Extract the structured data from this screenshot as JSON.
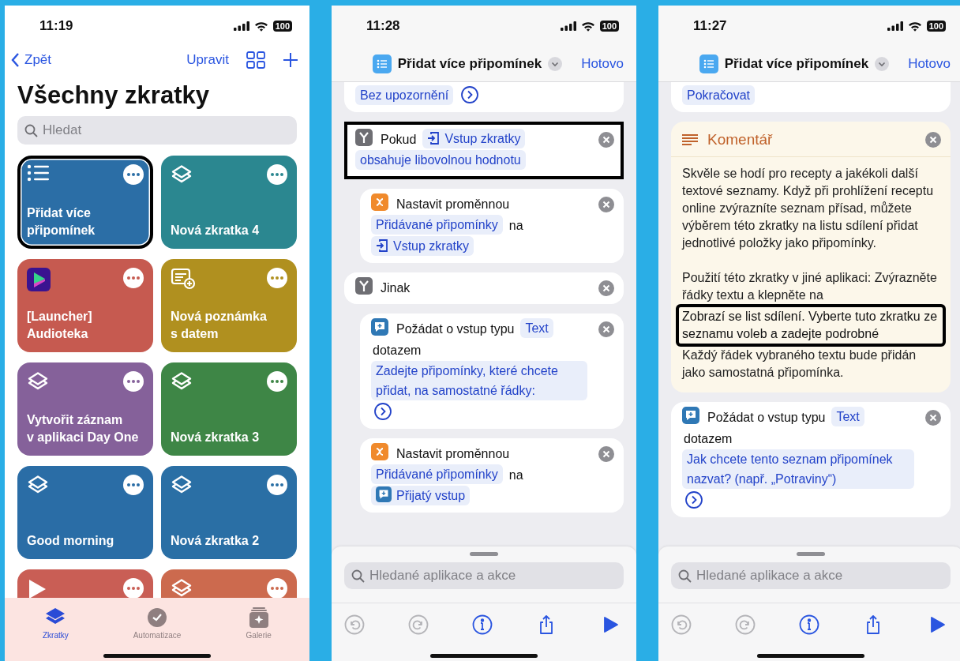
{
  "phones": [
    {
      "kind": "library",
      "time": "11:19",
      "battery": "100",
      "nav": {
        "back": "Zpět",
        "edit": "Upravit"
      },
      "title": "Všechny zkratky",
      "search": {
        "placeholder": "Hledat"
      },
      "tiles": [
        {
          "kind": "list",
          "title": "Přidat více\npřipomínek",
          "color": "#2b6ea6",
          "highlighted": true
        },
        {
          "kind": "layers",
          "title": "Nová zkratka 4",
          "color": "#2b8790",
          "highlighted": false
        },
        {
          "kind": "player",
          "title": "[Launcher]\nAudioteka",
          "color": "#c65a50",
          "highlighted": false
        },
        {
          "kind": "note",
          "title": "Nová poznámka\ns datem",
          "color": "#b0901f",
          "highlighted": false
        },
        {
          "kind": "layers",
          "title": "Vytvořit záznam\nv aplikaci Day One",
          "color": "#85619a",
          "highlighted": false
        },
        {
          "kind": "layers",
          "title": "Nová zkratka 3",
          "color": "#3e8646",
          "highlighted": false
        },
        {
          "kind": "layers",
          "title": "Good morning",
          "color": "#2a6da6",
          "highlighted": false
        },
        {
          "kind": "layers",
          "title": "Nová zkratka 2",
          "color": "#2a6fa5",
          "highlighted": false
        },
        {
          "kind": "play",
          "color": "#c95e55",
          "highlighted": false
        },
        {
          "kind": "layers",
          "color": "#cc6a4e",
          "highlighted": false
        }
      ],
      "tabs": [
        {
          "kind": "shortcuts",
          "label": "Zkratky",
          "selected": true
        },
        {
          "kind": "automation",
          "label": "Automatizace",
          "selected": false
        },
        {
          "kind": "gallery",
          "label": "Galerie",
          "selected": false
        }
      ]
    },
    {
      "kind": "editor",
      "time": "11:28",
      "battery": "100",
      "header": {
        "title": "Přidat více připomínek",
        "done": "Hotovo"
      },
      "actions": [
        {
          "kind": "partial",
          "parts": [
            {
              "kind": "chip",
              "text": "Bez upozornění"
            },
            {
              "kind": "more"
            }
          ]
        },
        {
          "kind": "if",
          "title": "Pokud",
          "highlighted": true,
          "parts": [
            {
              "kind": "input-chip",
              "text": "Vstup zkratky"
            },
            {
              "kind": "chip",
              "text": "obsahuje libovolnou hodnotu"
            }
          ],
          "children": [
            {
              "kind": "set",
              "title": "Nastavit proměnnou",
              "parts": [
                {
                  "kind": "chip",
                  "text": "Přidávané připomínky"
                },
                {
                  "kind": "label",
                  "text": "na"
                },
                {
                  "kind": "input-chip",
                  "text": "Vstup zkratky"
                }
              ]
            }
          ]
        },
        {
          "kind": "else",
          "title": "Jinak",
          "children": [
            {
              "kind": "ask",
              "title": "Požádat o vstup typu",
              "parts": [
                {
                  "kind": "chip",
                  "text": "Text"
                },
                {
                  "kind": "label",
                  "text": "dotazem"
                },
                {
                  "kind": "chip",
                  "text": "Zadejte připomínky, které chcete přidat, na samostatné řádky:"
                },
                {
                  "kind": "more"
                }
              ]
            },
            {
              "kind": "set",
              "title": "Nastavit proměnnou",
              "parts": [
                {
                  "kind": "chip",
                  "text": "Přidávané připomínky"
                },
                {
                  "kind": "label",
                  "text": "na"
                },
                {
                  "kind": "answer-chip",
                  "text": "Přijatý vstup"
                }
              ]
            }
          ]
        }
      ],
      "search": {
        "placeholder": "Hledané aplikace a akce"
      },
      "toolbar": [
        {
          "kind": "undo",
          "disabled": true
        },
        {
          "kind": "redo",
          "disabled": true
        },
        {
          "kind": "info",
          "disabled": false
        },
        {
          "kind": "share",
          "disabled": false
        },
        {
          "kind": "play",
          "disabled": false
        }
      ]
    },
    {
      "kind": "editor",
      "time": "11:27",
      "battery": "100",
      "header": {
        "title": "Přidat více připomínek",
        "done": "Hotovo"
      },
      "actions": [
        {
          "kind": "partial",
          "parts": [
            {
              "kind": "chip",
              "text": "Pokračovat"
            }
          ]
        },
        {
          "kind": "comment",
          "title": "Komentář",
          "blocks": [
            {
              "kind": "text",
              "text": "Skvěle se hodí pro recepty a jakékoli další textové seznamy. Když při prohlížení receptu online zvýrazníte seznam přísad, můžete výběrem této zkratky na listu sdílení přidat jednotlivé položky jako připomínky."
            },
            {
              "kind": "text",
              "text": "Použití této zkratky v jiné aplikaci: Zvýrazněte řádky textu a klepněte na"
            },
            {
              "kind": "callout",
              "text": "Zobrazí se list sdílení. Vyberte tuto zkratku ze seznamu voleb a zadejte podrobné"
            },
            {
              "kind": "text",
              "text": "Každý řádek vybraného textu bude přidán jako samostatná připomínka."
            }
          ]
        },
        {
          "kind": "ask",
          "title": "Požádat o vstup typu",
          "parts": [
            {
              "kind": "chip",
              "text": "Text"
            },
            {
              "kind": "label",
              "text": "dotazem"
            },
            {
              "kind": "chip",
              "text": "Jak chcete tento seznam připomínek nazvat? (např. „Potraviny“)"
            },
            {
              "kind": "more"
            }
          ]
        }
      ],
      "search": {
        "placeholder": "Hledané aplikace a akce"
      },
      "toolbar": [
        {
          "kind": "undo",
          "disabled": true
        },
        {
          "kind": "redo",
          "disabled": true
        },
        {
          "kind": "info",
          "disabled": false
        },
        {
          "kind": "share",
          "disabled": false
        },
        {
          "kind": "play",
          "disabled": false
        }
      ]
    }
  ]
}
